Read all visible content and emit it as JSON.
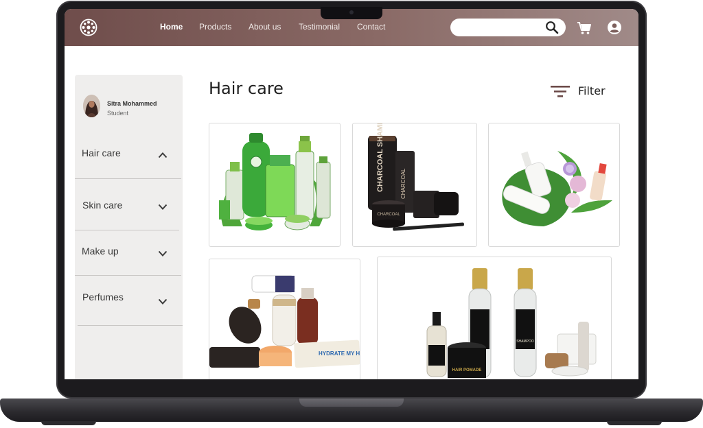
{
  "nav": {
    "links": [
      {
        "label": "Home",
        "active": true
      },
      {
        "label": "Products",
        "active": false
      },
      {
        "label": "About us",
        "active": false
      },
      {
        "label": "Testimonial",
        "active": false
      },
      {
        "label": "Contact",
        "active": false
      }
    ],
    "search": {
      "placeholder": "",
      "value": ""
    },
    "icons": [
      "logo-icon",
      "search-icon",
      "cart-icon",
      "account-icon"
    ],
    "gradient": [
      "#6f4d4b",
      "#a08a88"
    ]
  },
  "user": {
    "name": "Sitra Mohammed",
    "role": "Student"
  },
  "sidebar": {
    "categories": [
      {
        "label": "Hair care",
        "expanded": true
      },
      {
        "label": "Skin care",
        "expanded": false
      },
      {
        "label": "Make up",
        "expanded": false
      },
      {
        "label": "Perfumes",
        "expanded": false
      }
    ]
  },
  "main": {
    "title": "Hair care",
    "filter_label": "Filter"
  },
  "products": [
    {
      "image": "aloe-vera-hair-products"
    },
    {
      "image": "charcoal-shampoo-set"
    },
    {
      "image": "white-bottles-on-leaf"
    },
    {
      "image": "assorted-hair-products"
    },
    {
      "image": "black-shampoo-and-pomade-set"
    }
  ],
  "product_text": {
    "charcoal_shampoo": "CHARCOAL SHAMPOO",
    "charcoal_wash": "CHARCOAL",
    "charcoal_pot": "CHARCOAL",
    "pomade": "HAIR POMADE",
    "shampoo": "SHAMPOO",
    "hydrate": "HYDRATE MY HAIR"
  }
}
